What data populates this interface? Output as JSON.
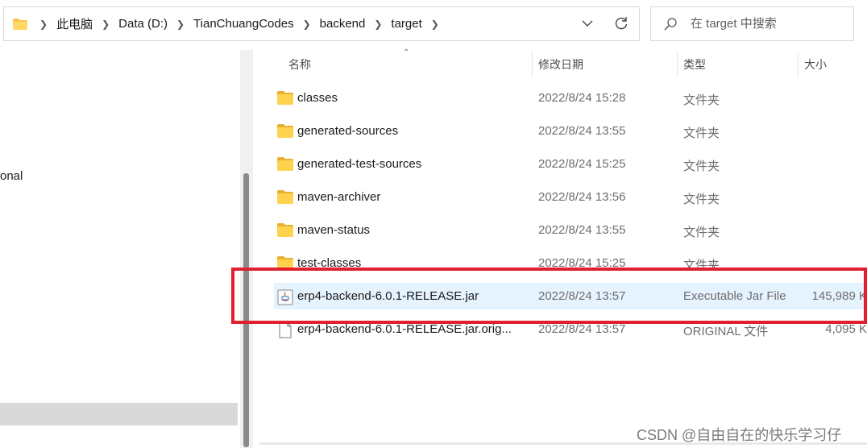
{
  "address_bar": {
    "breadcrumbs": [
      "此电脑",
      "Data (D:)",
      "TianChuangCodes",
      "backend",
      "target"
    ]
  },
  "search": {
    "placeholder": "在 target 中搜索"
  },
  "nav_pane": {
    "partial_label": "onal"
  },
  "columns": {
    "name": "名称",
    "date": "修改日期",
    "type": "类型",
    "size": "大小"
  },
  "files": [
    {
      "name": "classes",
      "date": "2022/8/24 15:28",
      "type": "文件夹",
      "size": "",
      "icon": "folder-icon"
    },
    {
      "name": "generated-sources",
      "date": "2022/8/24 13:55",
      "type": "文件夹",
      "size": "",
      "icon": "folder-icon"
    },
    {
      "name": "generated-test-sources",
      "date": "2022/8/24 15:25",
      "type": "文件夹",
      "size": "",
      "icon": "folder-icon"
    },
    {
      "name": "maven-archiver",
      "date": "2022/8/24 13:56",
      "type": "文件夹",
      "size": "",
      "icon": "folder-icon"
    },
    {
      "name": "maven-status",
      "date": "2022/8/24 13:55",
      "type": "文件夹",
      "size": "",
      "icon": "folder-icon"
    },
    {
      "name": "test-classes",
      "date": "2022/8/24 15:25",
      "type": "文件夹",
      "size": "",
      "icon": "folder-icon"
    },
    {
      "name": "erp4-backend-6.0.1-RELEASE.jar",
      "date": "2022/8/24 13:57",
      "type": "Executable Jar File",
      "size": "145,989 K",
      "icon": "java-jar-icon",
      "selected": true
    },
    {
      "name": "erp4-backend-6.0.1-RELEASE.jar.orig...",
      "date": "2022/8/24 13:57",
      "type": "ORIGINAL 文件",
      "size": "4,095 K",
      "icon": "file-icon"
    }
  ],
  "colors": {
    "highlight": "#e0202c",
    "selection": "#e5f3ff",
    "folder": "#f7c64a"
  },
  "watermark": "CSDN @自由自在的快乐学习仔"
}
